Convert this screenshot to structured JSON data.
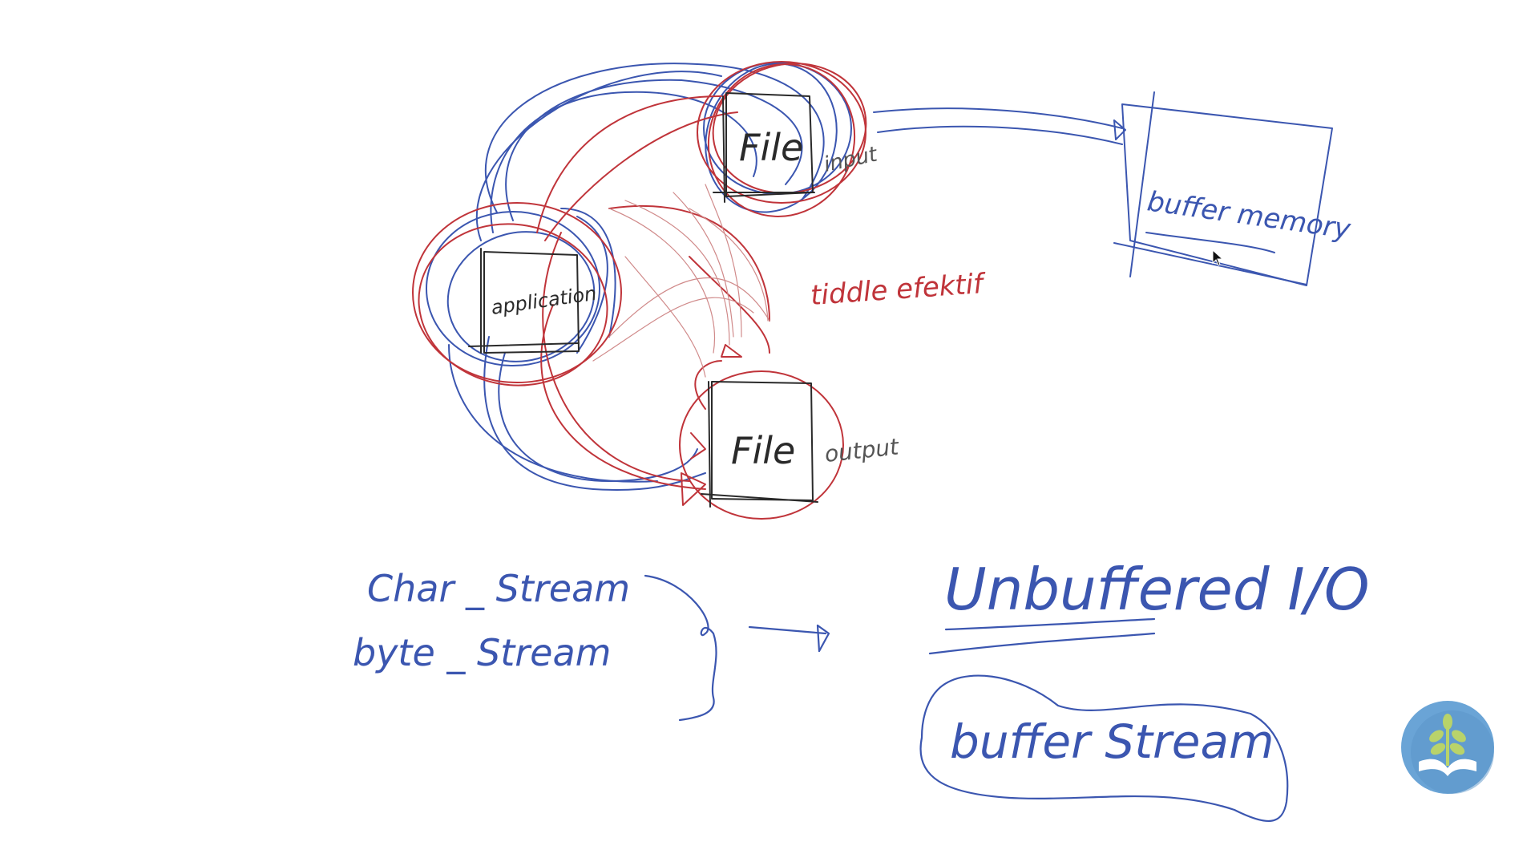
{
  "diagram": {
    "labels": {
      "file_top": "File",
      "file_top_caption": "input",
      "file_bottom": "File",
      "file_bottom_caption": "output",
      "application": "application",
      "buffer_memory": "buffer memory",
      "middle_note": "tiddle efektif",
      "char_stream": "Char _ Stream",
      "byte_stream": "byte _ Stream",
      "unbuffered_io": "Unbuffered I/O",
      "buffer_stream": "buffer Stream"
    }
  },
  "colors": {
    "ink_blue": "#3b56b0",
    "ink_red": "#c0343a",
    "ink_black": "#2a2a2a",
    "ink_grey": "#555555",
    "logo_bg": "#6aa4d6",
    "logo_leaf": "#b9d36a"
  },
  "icons": {
    "logo": "sprout-book-logo",
    "cursor": "mouse-cursor-icon"
  }
}
